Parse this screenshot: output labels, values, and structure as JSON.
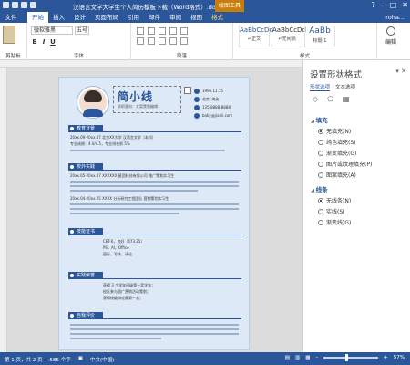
{
  "window": {
    "title": "汉语言文学大学生个人简历模板下载（Word格式）.docx - W...",
    "context_tab": "绘图工具",
    "user": "roha..."
  },
  "tabs": [
    {
      "label": "文件",
      "active": false
    },
    {
      "label": "开始",
      "active": true
    },
    {
      "label": "插入",
      "active": false
    },
    {
      "label": "设计",
      "active": false
    },
    {
      "label": "页面布局",
      "active": false
    },
    {
      "label": "引用",
      "active": false
    },
    {
      "label": "邮件",
      "active": false
    },
    {
      "label": "审阅",
      "active": false
    },
    {
      "label": "视图",
      "active": false
    },
    {
      "label": "格式",
      "active": false
    }
  ],
  "ribbon": {
    "clipboard_label": "剪贴板",
    "font_label": "字体",
    "paragraph_label": "段落",
    "styles_label": "样式",
    "edit_label": "编辑",
    "font_name": "微软雅黑",
    "font_size": "五号",
    "bold": "B",
    "italic": "I",
    "underline": "U",
    "styles": [
      {
        "preview": "AaBbCcDd",
        "name": "↵正文"
      },
      {
        "preview": "AaBbCcDd",
        "name": "↵无间隔"
      },
      {
        "preview": "AaBb",
        "name": "标题 1"
      }
    ]
  },
  "resume": {
    "name": "简小线",
    "intention": "求职意向：文案策划编辑",
    "contacts": [
      "1996.11.15",
      "北京•海淀",
      "135-8888-8888",
      "baby@jianli.com"
    ],
    "sections": [
      {
        "title": "教育背景"
      },
      {
        "title": "校外实践"
      },
      {
        "title": "技能证书"
      },
      {
        "title": "实践荣誉"
      },
      {
        "title": "自我评价"
      }
    ],
    "edu_row": "20xx.09-20xx.07      北京XX大学      汉语言文学（本科）",
    "edu_detail": "专业成绩：4.0/4.5，专业排名前 5%",
    "practice_row1": "20xx.05-20xx.07      XXXXXX 星团科技有限公司      推广策划实习生",
    "practice_row2": "20xx.04-20xx.05      XXXX 分析研究工程团队      营销策划实习生",
    "skills": [
      "CET-6，良好（473.25）",
      "PS，AI，Office",
      "国际，写作，评论"
    ],
    "awards": [
      "获得 3 个学年班级第一奖学金；",
      "校区参与国广营销活动策划；",
      "获得校级辩论赛第一名；"
    ]
  },
  "panel": {
    "title": "设置形状格式",
    "tabs": [
      "形状选项",
      "文本选项"
    ],
    "fill_section": "填充",
    "fill_options": [
      {
        "label": "无填充(N)",
        "selected": true
      },
      {
        "label": "纯色填充(S)",
        "selected": false
      },
      {
        "label": "渐变填充(G)",
        "selected": false
      },
      {
        "label": "图片或纹理填充(P)",
        "selected": false
      },
      {
        "label": "图案填充(A)",
        "selected": false
      }
    ],
    "line_section": "线条",
    "line_options": [
      {
        "label": "无线条(N)",
        "selected": true
      },
      {
        "label": "实线(S)",
        "selected": false
      },
      {
        "label": "渐变线(G)",
        "selected": false
      }
    ]
  },
  "status": {
    "page": "第 1 页，共 2 页",
    "words": "585 个字",
    "lang": "中文(中国)",
    "zoom": "57%"
  },
  "colors": {
    "accent": "#2b579a",
    "context": "#c97d0d",
    "page_bg": "#dde9f7"
  }
}
